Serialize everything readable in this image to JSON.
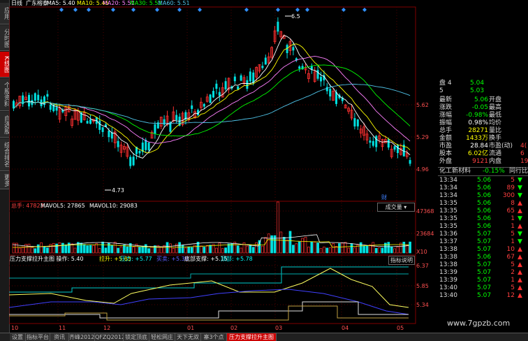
{
  "header": {
    "period": "日线",
    "stock": "广东榕泰",
    "ma": [
      {
        "label": "MA5: 5.40",
        "color": "#ffffff"
      },
      {
        "label": "MA10: 5.45",
        "color": "#ffff00"
      },
      {
        "label": "MA20: 5.51",
        "color": "#ff80ff"
      },
      {
        "label": "MA30: 5.51",
        "color": "#00ff00"
      },
      {
        "label": "MA60: 5.51",
        "color": "#4fc3e8"
      }
    ]
  },
  "left_tabs": [
    "应用",
    "分时图",
    "K线图",
    "个股资料",
    "自选股",
    "综合排名",
    "更多"
  ],
  "price_axis": [
    "5.62",
    "5.29",
    "4.96"
  ],
  "annotations": {
    "high": "6.5",
    "low": "4.73",
    "marker": "财"
  },
  "volume": {
    "header": [
      {
        "label": "总手: 47823",
        "color": "#ff4040"
      },
      {
        "label": "MAVOL5: 27865",
        "color": "#ffffff"
      },
      {
        "label": "MAVOL10: 29083",
        "color": "#ffffff"
      }
    ],
    "dropdown": "成交量",
    "axis": [
      "47368",
      "23684",
      "X10"
    ]
  },
  "indicator": {
    "header": [
      {
        "label": "压力支撑拉升主图 操作: 5.40",
        "color": "#ffffff"
      },
      {
        "label": "拉升: +5.63",
        "color": "#ffff00"
      },
      {
        "label": "压力: +5.77",
        "color": "#00ffff"
      },
      {
        "label": "买卖: +5.39",
        "color": "#6060ff"
      },
      {
        "label": "底部支撑: +5.15",
        "color": "#ffffff"
      },
      {
        "label": "顶部: +5.78",
        "color": "#00ffff"
      }
    ],
    "button": "指标说明",
    "axis": [
      "6.37",
      "5.85",
      "5.34"
    ]
  },
  "x_axis": [
    "10",
    "11",
    "12",
    "01",
    "02",
    "03",
    "04",
    "05"
  ],
  "quote": {
    "book": [
      {
        "k": "盘 4",
        "v": "5.04",
        "c": "#00ff00"
      },
      {
        "k": "5",
        "v": "5.03",
        "c": "#00ff00"
      }
    ],
    "rows": [
      {
        "k1": "最新",
        "v1": "5.06",
        "c1": "#00ff00",
        "k2": "开盘",
        "v2": ""
      },
      {
        "k1": "涨跌",
        "v1": "-0.05",
        "c1": "#00ff00",
        "k2": "最高",
        "v2": ""
      },
      {
        "k1": "涨幅",
        "v1": "-0.98%",
        "c1": "#00ff00",
        "k2": "最低",
        "v2": ""
      },
      {
        "k1": "振幅",
        "v1": "0.98%",
        "c1": "#ffffff",
        "k2": "均价",
        "v2": ""
      },
      {
        "k1": "总手",
        "v1": "28271",
        "c1": "#ffff00",
        "k2": "量比",
        "v2": ""
      },
      {
        "k1": "金额",
        "v1": "1433万",
        "c1": "#ffff00",
        "k2": "换手",
        "v2": ""
      },
      {
        "k1": "市盈",
        "v1": "28.84",
        "c1": "#ffffff",
        "k2": "市盈(动)",
        "v2": "4("
      },
      {
        "k1": "股本",
        "v1": "6.02亿",
        "c1": "#ffff00",
        "k2": "流通",
        "v2": "6"
      },
      {
        "k1": "外盘",
        "v1": "9121",
        "c1": "#ff4040",
        "k2": "内盘",
        "v2": "19"
      }
    ],
    "sector": {
      "name": "化工新材料",
      "change": "-0.15%",
      "right": "同行比较"
    },
    "ticks": [
      {
        "t": "13:34",
        "p": "5.06",
        "v": "5",
        "d": "down"
      },
      {
        "t": "13:34",
        "p": "5.06",
        "v": "89",
        "d": "down"
      },
      {
        "t": "13:34",
        "p": "5.06",
        "v": "300",
        "d": "down"
      },
      {
        "t": "13:35",
        "p": "5.06",
        "v": "8",
        "d": "up"
      },
      {
        "t": "13:35",
        "p": "5.06",
        "v": "65",
        "d": "up"
      },
      {
        "t": "13:35",
        "p": "5.06",
        "v": "1",
        "d": "down"
      },
      {
        "t": "13:35",
        "p": "5.06",
        "v": "1",
        "d": "up"
      },
      {
        "t": "13:36",
        "p": "5.07",
        "v": "5",
        "d": "down"
      },
      {
        "t": "13:37",
        "p": "5.07",
        "v": "1",
        "d": "down"
      },
      {
        "t": "13:38",
        "p": "5.07",
        "v": "10",
        "d": "up"
      },
      {
        "t": "13:38",
        "p": "5.06",
        "v": "67",
        "d": "up"
      },
      {
        "t": "13:38",
        "p": "5.07",
        "v": "5",
        "d": "up"
      },
      {
        "t": "13:39",
        "p": "5.07",
        "v": "2",
        "d": "up"
      },
      {
        "t": "13:39",
        "p": "5.07",
        "v": "1",
        "d": "up"
      },
      {
        "t": "13:40",
        "p": "5.07",
        "v": "5",
        "d": "up"
      },
      {
        "t": "13:40",
        "p": "5.07",
        "v": "12",
        "d": "up"
      }
    ]
  },
  "bottom_tabs": [
    {
      "label": "设置",
      "active": false
    },
    {
      "label": "指标平台",
      "active": false
    },
    {
      "label": "资讯",
      "active": false
    },
    {
      "label": "齐峰2012",
      "active": false
    },
    {
      "label": "QFZQ2012",
      "active": false
    },
    {
      "label": "锁定顶底",
      "active": false
    },
    {
      "label": "轻松网庄",
      "active": false
    },
    {
      "label": "天下无双",
      "active": false
    },
    {
      "label": "寨3个点",
      "active": false
    },
    {
      "label": "压力支撑拉升主图",
      "active": true
    }
  ],
  "watermark": "www.7gpzb.com"
}
